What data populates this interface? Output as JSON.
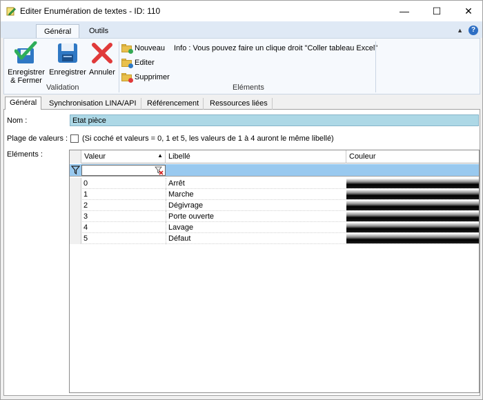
{
  "window": {
    "title": "Editer Enumération de textes - ID: 110",
    "minimize": "—",
    "maximize": "☐",
    "close": "✕"
  },
  "ribbon": {
    "tabs": [
      {
        "label": "Général",
        "active": true
      },
      {
        "label": "Outils",
        "active": false
      }
    ],
    "validation": {
      "group_label": "Validation",
      "save_close_line1": "Enregistrer",
      "save_close_line2": "& Fermer",
      "save": "Enregistrer",
      "cancel": "Annuler"
    },
    "elements": {
      "group_label": "Eléments",
      "new": "Nouveau",
      "edit": "Editer",
      "delete": "Supprimer",
      "info": "Info : Vous pouvez faire un clique droit \"Coller tableau Excel\""
    },
    "help": "?"
  },
  "content_tabs": [
    {
      "label": "Général",
      "active": true
    },
    {
      "label": "Synchronisation LINA/API",
      "active": false
    },
    {
      "label": "Référencement",
      "active": false
    },
    {
      "label": "Ressources liées",
      "active": false
    }
  ],
  "form": {
    "nom_label": "Nom :",
    "nom_value": "Etat pièce",
    "plage_label": "Plage de valeurs :",
    "plage_checked": false,
    "plage_hint": "(Si coché et valeurs = 0, 1 et 5, les valeurs de 1 à 4 auront le même libellé)",
    "elements_label": "Eléments :"
  },
  "grid": {
    "columns": [
      "Valeur",
      "Libellé",
      "Couleur"
    ],
    "sorted_column": "Valeur",
    "sort_direction": "ascending",
    "rows": [
      {
        "valeur": "0",
        "libelle": "Arrêt"
      },
      {
        "valeur": "1",
        "libelle": "Marche"
      },
      {
        "valeur": "2",
        "libelle": "Dégivrage"
      },
      {
        "valeur": "3",
        "libelle": "Porte ouverte"
      },
      {
        "valeur": "4",
        "libelle": "Lavage"
      },
      {
        "valeur": "5",
        "libelle": "Défaut"
      }
    ]
  },
  "colors": {
    "accent_blue": "#2e6fc4",
    "filter_row": "#99c9ef",
    "nom_field": "#add8e6",
    "ribbon_tabs_bg": "#dfe9f5"
  }
}
